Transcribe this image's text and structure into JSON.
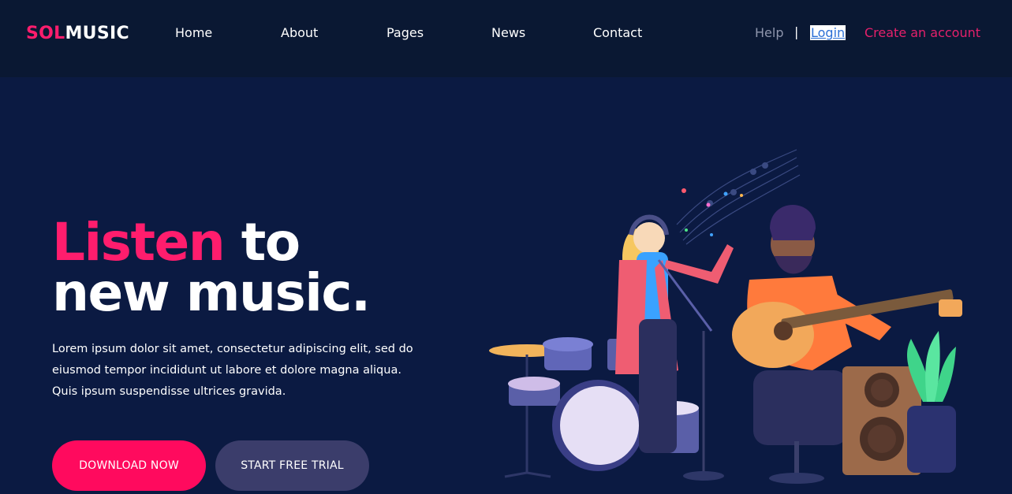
{
  "header": {
    "logo_part1": "SOL",
    "logo_part2": "MUSIC",
    "nav": [
      {
        "label": "Home"
      },
      {
        "label": "About"
      },
      {
        "label": "Pages"
      },
      {
        "label": "News"
      },
      {
        "label": "Contact"
      }
    ],
    "help": "Help",
    "separator": "|",
    "login": "Login",
    "create_account": "Create an account"
  },
  "hero": {
    "title_highlight": "Listen",
    "title_rest_1": " to",
    "title_line_2": "new music.",
    "description": "Lorem ipsum dolor sit amet, consectetur adipiscing elit, sed do eiusmod tempor incididunt ut labore et dolore magna aliqua. Quis ipsum suspendisse ultrices gravida.",
    "download_label": "DOWNLOAD NOW",
    "trial_label": "START FREE TRIAL"
  },
  "colors": {
    "accent": "#ff1d6d",
    "background": "#0b1a42",
    "header_bg": "#0a1833",
    "secondary_button": "#3b3d6b"
  },
  "illustration": {
    "icon": "band-illustration"
  }
}
